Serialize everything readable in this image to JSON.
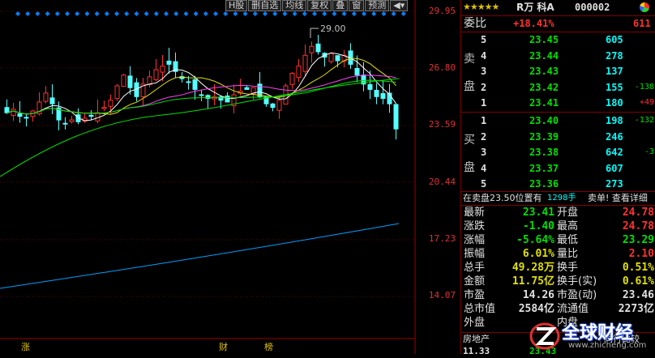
{
  "toolbar": {
    "buttons": [
      "H股",
      "删自选",
      "均线",
      "复权",
      "叠",
      "窗",
      "预测"
    ]
  },
  "price_axis": {
    "labels": [
      "29.95",
      "26.80",
      "23.59",
      "20.44",
      "17.23",
      "14.07"
    ],
    "values": [
      29.95,
      26.8,
      23.59,
      20.44,
      17.23,
      14.07
    ]
  },
  "high_annotation": "29.00",
  "bottom_marks": [
    "涨",
    "财",
    "榜"
  ],
  "colors": {
    "up": "#ff3030",
    "down": "#54ffff",
    "ma5": "#ffffff",
    "ma10": "#e0e000",
    "ma20": "#ff40ff",
    "ma60": "#00e000",
    "ma250": "#00a0ff",
    "diamond": "#0080ff"
  },
  "header": {
    "stars": "★★★★★",
    "name": "R万 科A",
    "code": "000002"
  },
  "weibi": {
    "label": "委比",
    "pct": "+18.41%",
    "diff": "611"
  },
  "sell": {
    "label1": "卖",
    "label2": "盘",
    "levels": [
      {
        "n": "5",
        "price": "23.45",
        "vol": "605",
        "chg": ""
      },
      {
        "n": "4",
        "price": "23.44",
        "vol": "278",
        "chg": ""
      },
      {
        "n": "3",
        "price": "23.43",
        "vol": "137",
        "chg": ""
      },
      {
        "n": "2",
        "price": "23.42",
        "vol": "155",
        "chg": "-138"
      },
      {
        "n": "1",
        "price": "23.41",
        "vol": "180",
        "chg": "+49"
      }
    ]
  },
  "buy": {
    "label1": "买",
    "label2": "盘",
    "levels": [
      {
        "n": "1",
        "price": "23.40",
        "vol": "198",
        "chg": "-132"
      },
      {
        "n": "2",
        "price": "23.39",
        "vol": "246",
        "chg": ""
      },
      {
        "n": "3",
        "price": "23.38",
        "vol": "642",
        "chg": "-3"
      },
      {
        "n": "4",
        "price": "23.37",
        "vol": "607",
        "chg": ""
      },
      {
        "n": "5",
        "price": "23.36",
        "vol": "273",
        "chg": ""
      }
    ]
  },
  "notice": {
    "text": "在卖盘23.50位置有",
    "vol": "1298手",
    "action": "卖单! 查看详细"
  },
  "stats": [
    {
      "l1": "最新",
      "v1": "23.41",
      "c1": "green",
      "l2": "开盘",
      "v2": "24.78",
      "c2": "red"
    },
    {
      "l1": "涨跌",
      "v1": "-1.40",
      "c1": "green",
      "l2": "最高",
      "v2": "24.78",
      "c2": "red"
    },
    {
      "l1": "涨幅",
      "v1": "-5.64%",
      "c1": "green",
      "l2": "最低",
      "v2": "23.29",
      "c2": "green"
    },
    {
      "l1": "振幅",
      "v1": "6.01%",
      "c1": "yellow",
      "l2": "量比",
      "v2": "2.10",
      "c2": "red"
    },
    {
      "l1": "总手",
      "v1": "49.28万",
      "c1": "yellow",
      "l2": "换手",
      "v2": "0.51%",
      "c2": "yellow"
    },
    {
      "l1": "金额",
      "v1": "11.75亿",
      "c1": "yellow",
      "l2": "换手(实)",
      "v2": "0.61%",
      "c2": "yellow"
    },
    {
      "l1": "市盈",
      "v1": "14.26",
      "c1": "white",
      "l2": "市盈(动)",
      "v2": "23.46",
      "c2": "white"
    },
    {
      "l1": "总市值",
      "v1": "2584亿",
      "c1": "white",
      "l2": "流通值",
      "v2": "2273亿",
      "c2": "white"
    },
    {
      "l1": "外盘",
      "v1": "",
      "c1": "red",
      "l2": "内盘",
      "v2": "",
      "c2": "green"
    }
  ],
  "footer": {
    "sector": "房地产",
    "compare": "同行比较",
    "row2_left": "11.33",
    "row2_mid": "23.43"
  },
  "watermark": {
    "text": "全球财经",
    "url": "www.zhicheng.com"
  }
}
